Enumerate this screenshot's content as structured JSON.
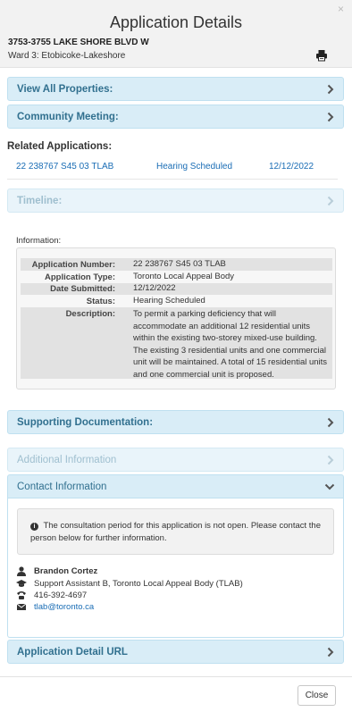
{
  "header": {
    "title": "Application Details",
    "close_symbol": "×",
    "address": "3753-3755 LAKE SHORE BLVD W",
    "ward": "Ward 3: Etobicoke-Lakeshore",
    "print_icon": "printer-icon"
  },
  "panels": {
    "view_all": "View All Properties:",
    "community": "Community Meeting:",
    "timeline": "Timeline:",
    "supporting": "Supporting Documentation:",
    "additional": "Additional Information",
    "contact": "Contact Information",
    "detail_url": "Application Detail URL"
  },
  "related": {
    "heading": "Related Applications:",
    "rows": [
      {
        "number": "22 238767 S45 03 TLAB",
        "status": "Hearing Scheduled",
        "date": "12/12/2022"
      }
    ]
  },
  "information": {
    "label": "Information:",
    "rows": [
      {
        "label": "Application Number:",
        "value": "22 238767 S45 03 TLAB"
      },
      {
        "label": "Application Type:",
        "value": "Toronto Local Appeal Body"
      },
      {
        "label": "Date Submitted:",
        "value": "12/12/2022"
      },
      {
        "label": "Status:",
        "value": "Hearing Scheduled"
      },
      {
        "label": "Description:",
        "value": "To permit a parking deficiency that will accommodate an additional 12 residential units within the existing two-storey mixed-use building. The existing 3 residential units and one commercial unit will be maintained. A total of 15 residential units and one commercial unit is proposed."
      }
    ]
  },
  "contact": {
    "notice": "The consultation period for this application is not open. Please contact the person below for further information.",
    "name": "Brandon Cortez",
    "title": "Support Assistant B, Toronto Local Appeal Body (TLAB)",
    "phone": "416-392-4697",
    "email": "tlab@toronto.ca"
  },
  "footer": {
    "close_label": "Close"
  },
  "colors": {
    "panel_bg": "#d9edf7",
    "panel_text": "#31708f",
    "link": "#1a6db5"
  }
}
